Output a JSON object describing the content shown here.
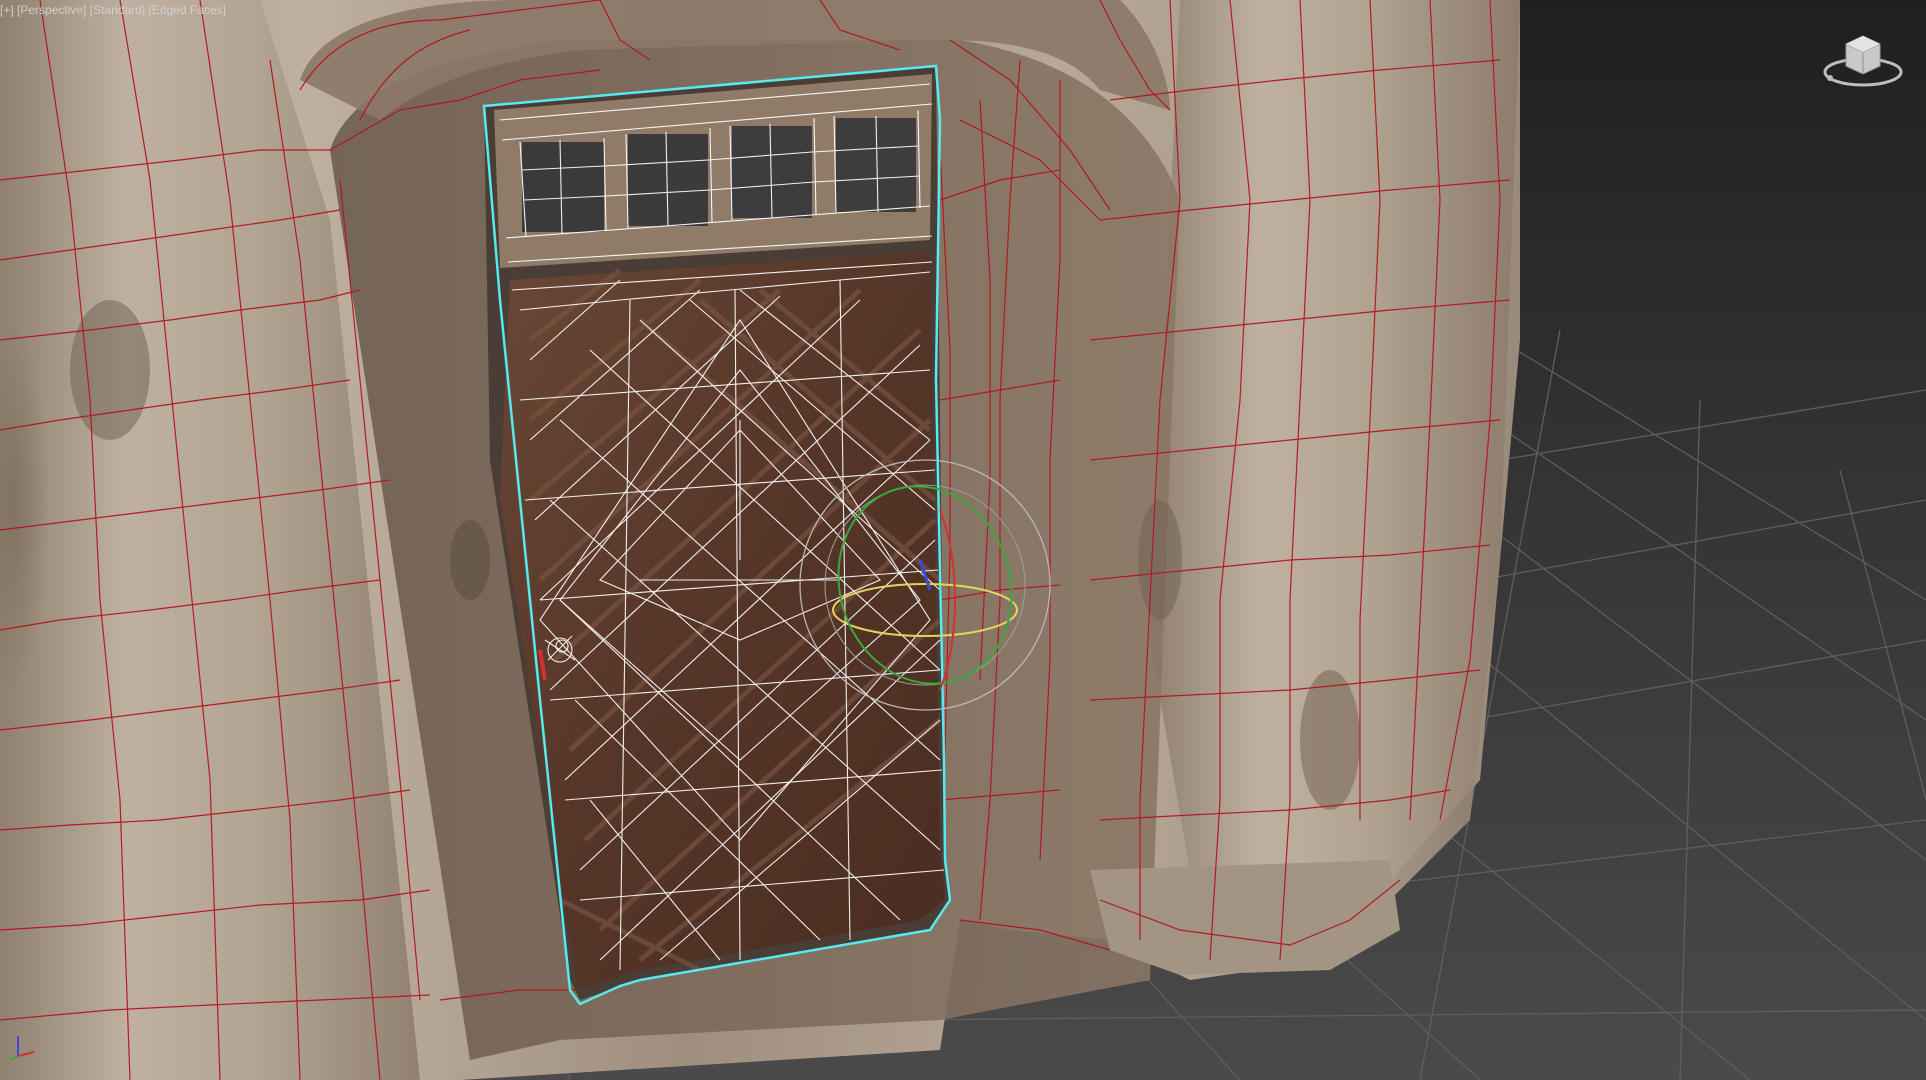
{
  "viewport": {
    "label_prefix": "[+]",
    "view_mode": "[Perspective]",
    "shading_preset": "[Standard]",
    "display_mode": "[Edged Faces]"
  },
  "colors": {
    "background_top": "#1f1f1f",
    "background_bottom": "#4a4a4a",
    "grid_line": "#5a5a5a",
    "wall_mesh_edges": "#b3161b",
    "door_mesh_edges": "#ffffff",
    "selection_outline": "#58e8f0",
    "gizmo_x": "#d33030",
    "gizmo_y": "#3aa83a",
    "gizmo_z": "#3b4bd6",
    "gizmo_view": "#e5d35a",
    "gizmo_screen": "#b8b8b8",
    "wood": "#5a3a2a",
    "plaster": "#b5a594"
  },
  "icons": {
    "viewcube": "viewcube-icon",
    "axis_tripod": "axis-tripod-icon",
    "rotate_gizmo": "rotate-gizmo-icon"
  },
  "objects": {
    "selected": "door-mesh",
    "scene": [
      "wall-mesh",
      "door-mesh",
      "ground-grid"
    ]
  }
}
